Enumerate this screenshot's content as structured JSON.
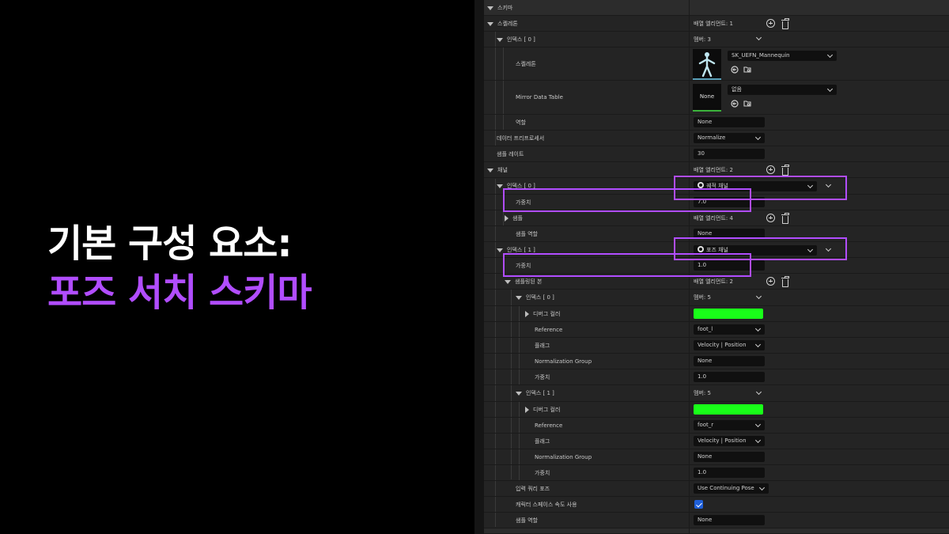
{
  "title": {
    "line1": "기본 구성 요소:",
    "line2": "포즈 서치 스키마"
  },
  "panel": {
    "section_header": "스키마",
    "skeletons": {
      "label": "스켈레톤",
      "array_count": "배열 엘리먼트: 1",
      "index0_label": "인덱스 [ 0 ]",
      "index0_members": "멤버: 3",
      "skeleton_label": "스켈레톤",
      "skeleton_value": "SK_UEFN_Mannequin",
      "mirror_label": "Mirror Data Table",
      "mirror_value": "없음",
      "mirror_thumb": "None",
      "role_label": "역할",
      "role_value": "None"
    },
    "data_preprocessor_label": "데이터 프리프로세서",
    "data_preprocessor_value": "Normalize",
    "sample_rate_label": "샘플 레이트",
    "sample_rate_value": "30",
    "channels": {
      "label": "채널",
      "array_count": "배열 엘리먼트: 2",
      "index0_label": "인덱스 [ 0 ]",
      "index0_type": "궤적 채널",
      "index0_weight_label": "가중치",
      "index0_weight_value": "7.0",
      "samples_label": "샘플",
      "samples_count": "배열 엘리먼트: 4",
      "sample_role_label": "샘플 역할",
      "sample_role_value": "None",
      "index1_label": "인덱스 [ 1 ]",
      "index1_type": "포즈 채널",
      "index1_weight_label": "가중치",
      "index1_weight_value": "1.0",
      "sampled_bones_label": "샘플링된 본",
      "sampled_bones_count": "배열 엘리먼트: 2",
      "bones": [
        {
          "index_label": "인덱스 [ 0 ]",
          "members": "멤버: 5",
          "debug_color_label": "디버그 컬러",
          "reference_label": "Reference",
          "reference_value": "foot_l",
          "flags_label": "플래그",
          "flags_value": "Velocity | Position",
          "norm_group_label": "Normalization Group",
          "norm_group_value": "None",
          "weight_label": "가중치",
          "weight_value": "1.0"
        },
        {
          "index_label": "인덱스 [ 1 ]",
          "members": "멤버: 5",
          "debug_color_label": "디버그 컬러",
          "reference_label": "Reference",
          "reference_value": "foot_r",
          "flags_label": "플래그",
          "flags_value": "Velocity | Position",
          "norm_group_label": "Normalization Group",
          "norm_group_value": "None",
          "weight_label": "가중치",
          "weight_value": "1.0"
        }
      ],
      "input_query_pose_label": "입력 쿼리 포즈",
      "input_query_pose_value": "Use Continuing Pose",
      "use_char_space_vel_label": "캐릭터 스페이스 속도 사용",
      "sample_role2_label": "샘플 역할",
      "sample_role2_value": "None"
    }
  },
  "colors": {
    "accent_purple": "#b14dff",
    "debug_green": "#19ff19",
    "checkbox_blue": "#1f5fd8"
  }
}
